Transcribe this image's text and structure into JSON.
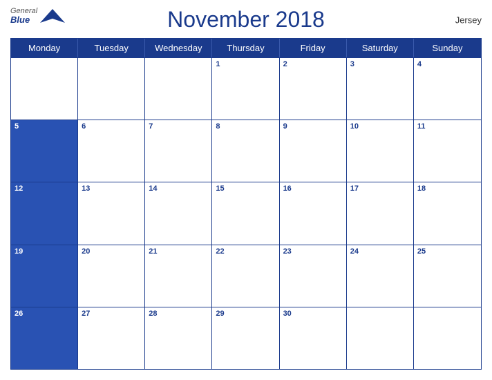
{
  "header": {
    "logo": {
      "general": "General",
      "blue": "Blue",
      "bird_symbol": "▲"
    },
    "title": "November 2018",
    "region": "Jersey"
  },
  "day_headers": [
    "Monday",
    "Tuesday",
    "Wednesday",
    "Thursday",
    "Friday",
    "Saturday",
    "Sunday"
  ],
  "weeks": [
    [
      null,
      null,
      null,
      1,
      2,
      3,
      4
    ],
    [
      5,
      6,
      7,
      8,
      9,
      10,
      11
    ],
    [
      12,
      13,
      14,
      15,
      16,
      17,
      18
    ],
    [
      19,
      20,
      21,
      22,
      23,
      24,
      25
    ],
    [
      26,
      27,
      28,
      29,
      30,
      null,
      null
    ]
  ],
  "colors": {
    "primary_blue": "#1a3a8c",
    "header_blue": "#2952b3",
    "white": "#ffffff",
    "border": "#1a3a8c"
  }
}
